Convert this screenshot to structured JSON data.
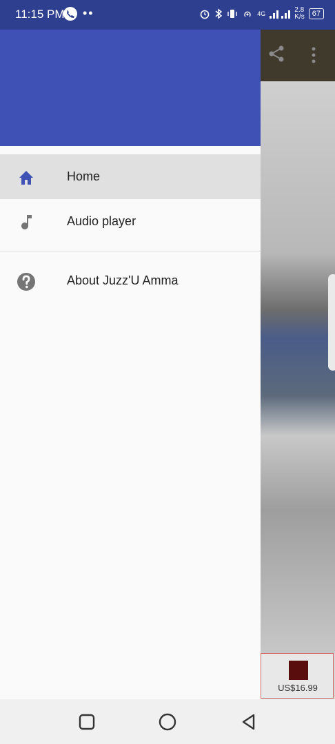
{
  "status_bar": {
    "time": "11:15 PM",
    "notification_dots": "••",
    "network_type": "4G",
    "speed_value": "2.8",
    "speed_unit": "K/s",
    "battery": "67"
  },
  "background_app": {
    "ad_price": "US$16.99"
  },
  "drawer": {
    "header_color": "#3f51b5",
    "items": [
      {
        "label": "Home",
        "icon": "home-icon",
        "active": true
      },
      {
        "label": "Audio player",
        "icon": "music-note-icon",
        "active": false
      },
      {
        "label": "About Juzz'U Amma",
        "icon": "help-icon",
        "active": false
      }
    ]
  },
  "colors": {
    "accent": "#3f51b5",
    "status_bar": "#2e3f8f",
    "icon_gray": "#757575"
  }
}
